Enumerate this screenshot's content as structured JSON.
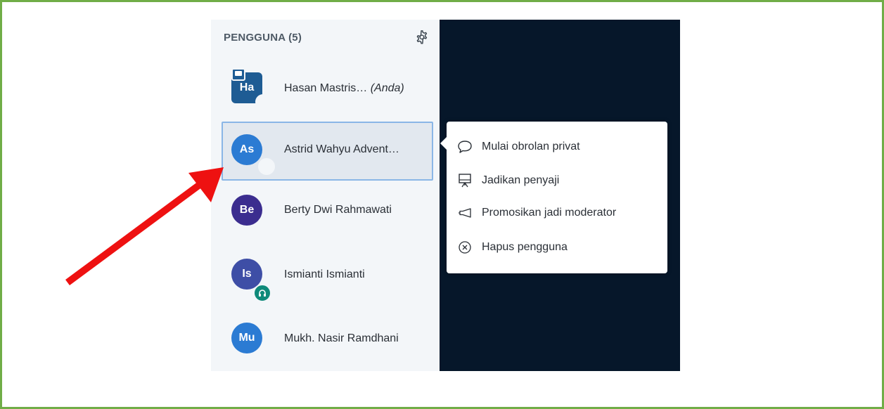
{
  "userlist": {
    "header": "PENGGUNA (5)",
    "settings_icon": "gear-icon",
    "users": [
      {
        "initials": "Ha",
        "name": "Hasan Mastris…",
        "suffix": "(Anda)",
        "color": "#1e5c94",
        "role": "moderator"
      },
      {
        "initials": "As",
        "name": "Astrid Wahyu Advent…",
        "color": "#2b7bd3",
        "role": "viewer"
      },
      {
        "initials": "Be",
        "name": "Berty Dwi Rahmawati",
        "color": "#3b2d8f",
        "role": "viewer"
      },
      {
        "initials": "Is",
        "name": "Ismianti Ismianti",
        "color": "#3e4ea6",
        "role": "viewer",
        "status": "listen-only"
      },
      {
        "initials": "Mu",
        "name": "Mukh. Nasir Ramdhani",
        "color": "#2b7bd3",
        "role": "viewer"
      }
    ]
  },
  "context_menu": {
    "items": [
      {
        "label": "Mulai obrolan privat",
        "icon": "chat-bubble-icon"
      },
      {
        "label": "Jadikan penyaji",
        "icon": "presentation-icon"
      },
      {
        "label": "Promosikan jadi moderator",
        "icon": "megaphone-icon"
      },
      {
        "label": "Hapus pengguna",
        "icon": "circle-x-icon"
      }
    ]
  },
  "colors": {
    "frame_border": "#70ad47",
    "dark_panel": "#06172a",
    "annotation_arrow": "#ee1111",
    "selection_border": "#8ab6e6"
  }
}
